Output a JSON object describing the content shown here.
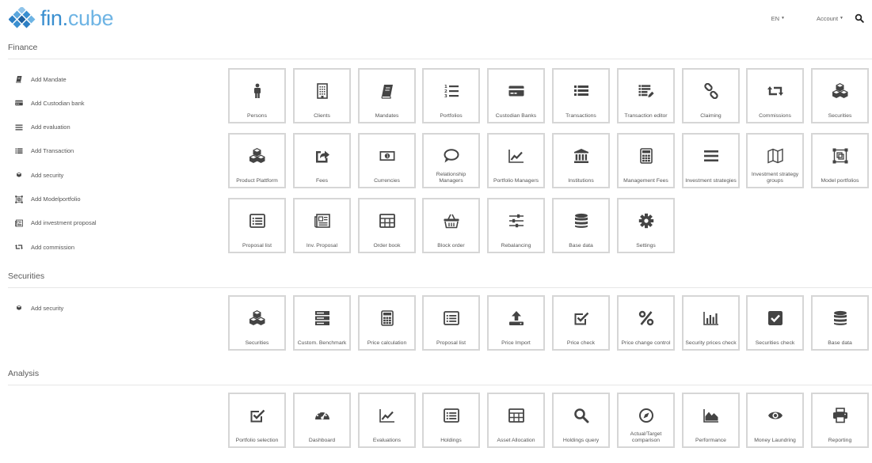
{
  "brand": {
    "name_main": "fin.",
    "name_sub": "cube"
  },
  "nav": {
    "language": "EN",
    "account": "Account"
  },
  "sections": [
    {
      "title": "Finance",
      "links": [
        {
          "label": "Add Mandate",
          "icon": "book-icon"
        },
        {
          "label": "Add Custodian bank",
          "icon": "credit-card-icon"
        },
        {
          "label": "Add evaluation",
          "icon": "bars-icon"
        },
        {
          "label": "Add Transaction",
          "icon": "list-icon"
        },
        {
          "label": "Add security",
          "icon": "cube-icon"
        },
        {
          "label": "Add Modelportfolio",
          "icon": "frame-icon"
        },
        {
          "label": "Add investment proposal",
          "icon": "newspaper-icon"
        },
        {
          "label": "Add commission",
          "icon": "retweet-icon"
        }
      ],
      "tiles": [
        {
          "label": "Persons",
          "icon": "male-icon"
        },
        {
          "label": "Clients",
          "icon": "building-icon"
        },
        {
          "label": "Mandates",
          "icon": "book-icon"
        },
        {
          "label": "Portfolios",
          "icon": "list-ol-icon"
        },
        {
          "label": "Custodian Banks",
          "icon": "credit-card-icon"
        },
        {
          "label": "Transactions",
          "icon": "list-icon"
        },
        {
          "label": "Transaction editor",
          "icon": "list-edit-icon"
        },
        {
          "label": "Claiming",
          "icon": "link-icon"
        },
        {
          "label": "Commissions",
          "icon": "retweet-icon"
        },
        {
          "label": "Securities",
          "icon": "cubes-icon"
        },
        {
          "label": "Product Plattform",
          "icon": "cubes-icon"
        },
        {
          "label": "Fees",
          "icon": "share-icon"
        },
        {
          "label": "Currencies",
          "icon": "money-icon"
        },
        {
          "label": "Relationship Managers",
          "icon": "comment-icon"
        },
        {
          "label": "Portfolio Managers",
          "icon": "line-chart-icon"
        },
        {
          "label": "Institutions",
          "icon": "bank-icon"
        },
        {
          "label": "Management Fees",
          "icon": "calculator-icon"
        },
        {
          "label": "Investment strategies",
          "icon": "bars-icon"
        },
        {
          "label": "Investment strategy groups",
          "icon": "map-icon"
        },
        {
          "label": "Model portfolios",
          "icon": "frame-icon"
        },
        {
          "label": "Proposal list",
          "icon": "list-alt-icon"
        },
        {
          "label": "Inv. Proposal",
          "icon": "newspaper-icon"
        },
        {
          "label": "Order book",
          "icon": "table-icon"
        },
        {
          "label": "Block order",
          "icon": "basket-icon"
        },
        {
          "label": "Rebalancing",
          "icon": "sliders-icon"
        },
        {
          "label": "Base data",
          "icon": "database-icon"
        },
        {
          "label": "Settings",
          "icon": "cog-icon"
        }
      ]
    },
    {
      "title": "Securities",
      "links": [
        {
          "label": "Add security",
          "icon": "cube-icon"
        }
      ],
      "tiles": [
        {
          "label": "Securities",
          "icon": "cubes-icon"
        },
        {
          "label": "Custom. Benchmark",
          "icon": "server-icon"
        },
        {
          "label": "Price calculation",
          "icon": "calculator-icon"
        },
        {
          "label": "Proposal list",
          "icon": "list-alt-icon"
        },
        {
          "label": "Price Import",
          "icon": "upload-icon"
        },
        {
          "label": "Price check",
          "icon": "check-square-o-icon"
        },
        {
          "label": "Price change control",
          "icon": "percent-icon"
        },
        {
          "label": "Security prices check",
          "icon": "bar-chart-icon"
        },
        {
          "label": "Securities check",
          "icon": "check-square-icon"
        },
        {
          "label": "Base data",
          "icon": "database-icon"
        }
      ]
    },
    {
      "title": "Analysis",
      "links": [],
      "tiles": [
        {
          "label": "Portfolio selection",
          "icon": "check-square-o-icon"
        },
        {
          "label": "Dashboard",
          "icon": "dashboard-icon"
        },
        {
          "label": "Evaluations",
          "icon": "line-chart-icon"
        },
        {
          "label": "Holdings",
          "icon": "list-alt-icon"
        },
        {
          "label": "Asset Allocation",
          "icon": "table-icon"
        },
        {
          "label": "Holdings query",
          "icon": "search-icon"
        },
        {
          "label": "Actual/Target comparison",
          "icon": "compass-icon"
        },
        {
          "label": "Performance",
          "icon": "area-chart-icon"
        },
        {
          "label": "Money Laundring",
          "icon": "eye-icon"
        },
        {
          "label": "Reporting",
          "icon": "print-icon"
        }
      ]
    }
  ]
}
